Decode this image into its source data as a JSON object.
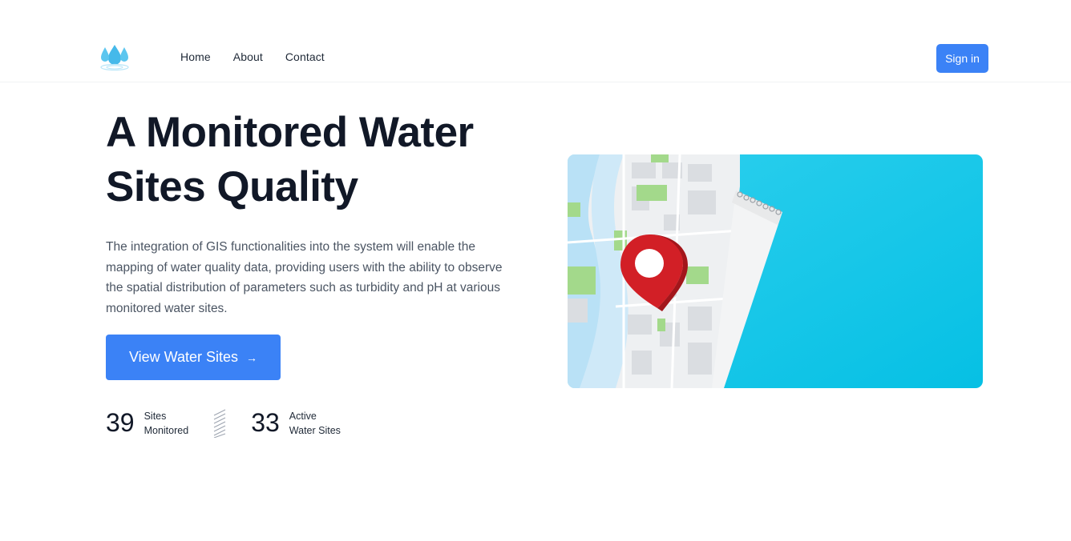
{
  "header": {
    "logo_icon": "water-drops-logo-icon",
    "nav": [
      {
        "label": "Home"
      },
      {
        "label": "About"
      },
      {
        "label": "Contact"
      }
    ],
    "signin_label": "Sign in"
  },
  "hero": {
    "title": "A Monitored Water Sites Quality",
    "description": "The integration of GIS functionalities into the system will enable the mapping of water quality data, providing users with the ability to observe the spatial distribution of parameters such as turbidity and pH at various monitored water sites.",
    "cta_label": "View Water Sites",
    "cta_icon": "arrow-right-icon",
    "stats": [
      {
        "value": "39",
        "label_line1": "Sites",
        "label_line2": "Monitored"
      },
      {
        "value": "33",
        "label_line1": "Active",
        "label_line2": "Water Sites"
      }
    ],
    "image_icon": "map-location-pin-illustration"
  },
  "colors": {
    "accent": "#3b82f6",
    "heading": "#111827",
    "body_text": "#4b5563",
    "image_bg": "#11c3e6",
    "pin": "#d21f26"
  }
}
